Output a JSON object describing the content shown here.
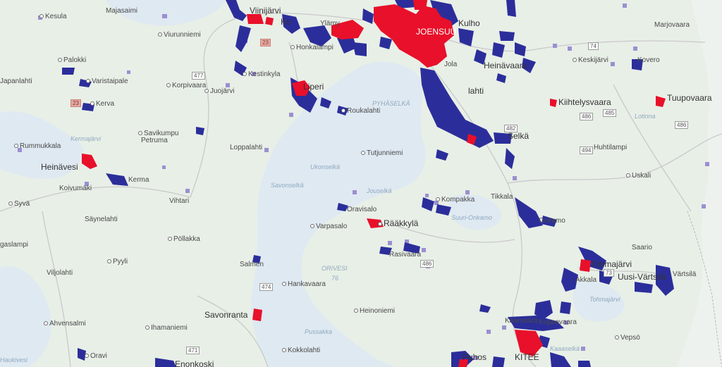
{
  "colors": {
    "land": "#e8efe7",
    "water": "#dfe9f2",
    "road": "#c9c9c9",
    "border": "#b8b8b8",
    "urban_red": "#e8102a",
    "rural_blue": "#2b2e9a",
    "sparse_purple": "#9b8fd0"
  },
  "labels": {
    "kesula": "Kesula",
    "majasaimi": "Majasaimi",
    "viinijarvi": "Viinijärvi",
    "viurunniemi": "Viurunniemi",
    "ylamylly": "Ylämy",
    "joensuu": "JOENSUU",
    "kulho": "Kulho",
    "kontiolahti": "Ko",
    "marjovaara": "Marjovaara",
    "palokki": "Palokki",
    "varislahti": "Varistaipale",
    "japanlahti": "Japanlahti",
    "honkalampi": "Honkalampi",
    "sotkuma": "Kestinkyla",
    "korpivaara": "Korpivaara",
    "juojarvi": "Juojärvi",
    "liperi": "Liperi",
    "jola": "Jola",
    "heinavaara": "Heinävaara",
    "keskijarvi": "Keskijärvi",
    "kovero": "Kovero",
    "tuupovaara": "Tuupovaara",
    "kerva": "Kerva",
    "roukalahti": "Roukalahti",
    "pyhaselka": "PYHÄSELKÄ",
    "lahti": "lahti",
    "kiihtelysvaara": "Kiihtelysvaara",
    "lotinna": "Lotinna",
    "rummukkala": "Rummukkala",
    "kermajarvi": "Kermajärvi",
    "savikumpu": "Savikumpu",
    "petruma": "Petruma",
    "loppalahti": "Loppalahti",
    "tutjunniemi": "Tutjunniemi",
    "selka": "Selkä",
    "huhtilampi": "Huhtilampi",
    "heinavesi": "Heinävesi",
    "ukonselka": "Ukonselkä",
    "uskali": "Uskali",
    "koivumaki": "Koivumäki",
    "kerma": "Kerma",
    "vihtari": "Vihtari",
    "savonselka": "Savonselkä",
    "jouselka": "Jouselkä",
    "tikkala": "Tikkala",
    "kompakka": "Kompakka",
    "syvaj": "Syvä",
    "saynelahti": "Säynelahti",
    "oravisalo": "Oravisalo",
    "suuri_onkamo": "Suuri-Onkamo",
    "onkamo": "Onkamo",
    "verposalo": "Varpasalo",
    "raakkyla": "Rääkkylä",
    "gaslampi": "gaslampi",
    "pollakka": "Pöllakka",
    "rasivaara": "Rasivaara",
    "saario": "Saario",
    "tohmajarvi": "Tohmajärvi",
    "pyyli": "Pyyli",
    "salmen": "Salmen",
    "orivesi": "ORIVESI",
    "orivesi_num": "76",
    "akkala": "Akkala",
    "uusi_vartsila": "Uusi-Värtsilä",
    "vartsila": "Värtsilä",
    "viljolahti": "Viljolahti",
    "hankavaara": "Hankavaara",
    "tohmajarvi_lake": "Tohmajärvi",
    "savonranta": "Savonranta",
    "heinoniemi": "Heinoniemi",
    "ahvensalmi": "Ahvensalmi",
    "ihamaniemi": "Ihamaniemi",
    "puhos_vaara": "Kuppovaara",
    "kaakko": "Kaaruaara",
    "pussakka": "Pussakka",
    "veps": "Vepsö",
    "kokkolahti": "Kokkolahti",
    "kaaaselka": "Kaaaselkä",
    "puhos": "Puhos",
    "kitee": "KITEE",
    "oravi": "Oravi",
    "enonkoski": "Enonkoski",
    "haukivesi": "Haukivesi"
  },
  "roads": {
    "r1": "477",
    "r2": "23",
    "r3": "74",
    "r4": "485",
    "r5": "486",
    "r6": "494",
    "r7": "482",
    "r8": "474",
    "r9": "471",
    "r10": "486",
    "r11": "23",
    "r12": "73",
    "r13": "486"
  }
}
